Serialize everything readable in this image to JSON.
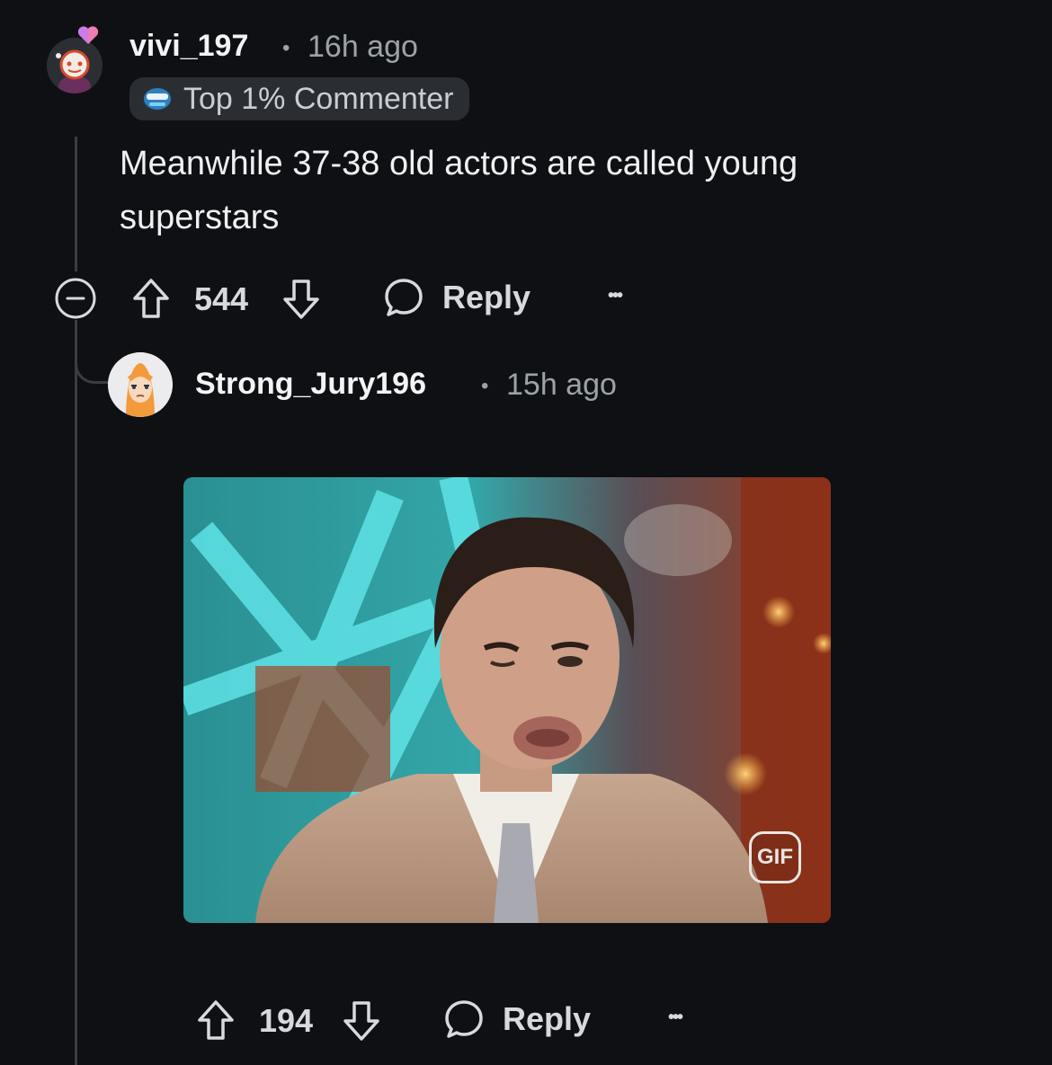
{
  "comment": {
    "username": "vivi_197",
    "time": "16h ago",
    "flair": "Top 1% Commenter",
    "body_line1": "Meanwhile 37-38 old actors are called young",
    "body_line2": "superstars",
    "votes": "544",
    "reply_label": "Reply",
    "more_label": "•••"
  },
  "reply": {
    "username": "Strong_Jury196",
    "time": "15h ago",
    "gif_label": "GIF",
    "votes": "194",
    "reply_label": "Reply",
    "more_label": "•••"
  },
  "colors": {
    "background": "#0e1013",
    "thread_line": "#3a3d41",
    "flair_bg": "#2a2e33"
  },
  "icons": [
    "snoo-avatar-icon",
    "flair-icon",
    "collapse-icon",
    "upvote-icon",
    "downvote-icon",
    "comment-bubble-icon",
    "more-options-icon",
    "gif-badge-icon"
  ]
}
